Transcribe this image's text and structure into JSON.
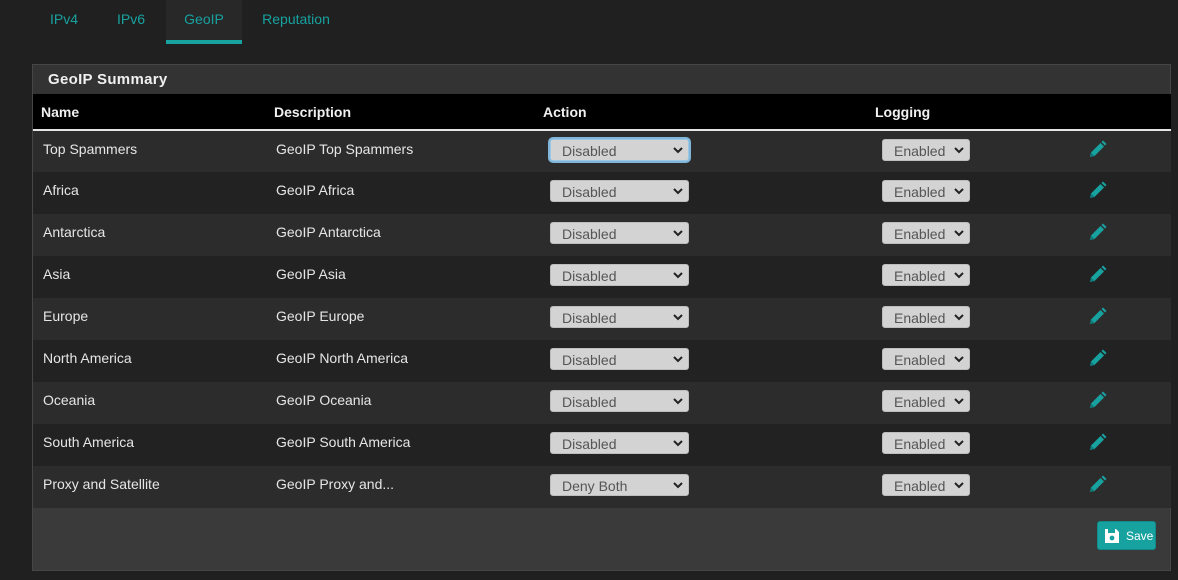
{
  "tabs": [
    {
      "label": "IPv4",
      "active": false
    },
    {
      "label": "IPv6",
      "active": false
    },
    {
      "label": "GeoIP",
      "active": true
    },
    {
      "label": "Reputation",
      "active": false
    }
  ],
  "panel": {
    "title": "GeoIP Summary",
    "columns": {
      "name": "Name",
      "description": "Description",
      "action": "Action",
      "logging": "Logging"
    },
    "rows": [
      {
        "name": "Top Spammers",
        "description": "GeoIP Top Spammers",
        "action": "Disabled",
        "logging": "Enabled"
      },
      {
        "name": "Africa",
        "description": "GeoIP Africa",
        "action": "Disabled",
        "logging": "Enabled"
      },
      {
        "name": "Antarctica",
        "description": "GeoIP Antarctica",
        "action": "Disabled",
        "logging": "Enabled"
      },
      {
        "name": "Asia",
        "description": "GeoIP Asia",
        "action": "Disabled",
        "logging": "Enabled"
      },
      {
        "name": "Europe",
        "description": "GeoIP Europe",
        "action": "Disabled",
        "logging": "Enabled"
      },
      {
        "name": "North America",
        "description": "GeoIP North America",
        "action": "Disabled",
        "logging": "Enabled"
      },
      {
        "name": "Oceania",
        "description": "GeoIP Oceania",
        "action": "Disabled",
        "logging": "Enabled"
      },
      {
        "name": "South America",
        "description": "GeoIP South America",
        "action": "Disabled",
        "logging": "Enabled"
      },
      {
        "name": "Proxy and Satellite",
        "description": "GeoIP Proxy and...",
        "action": "Deny Both",
        "logging": "Enabled"
      }
    ],
    "save_label": "Save"
  },
  "icons": {
    "edit": "pencil-icon",
    "save": "floppy-disk-icon",
    "dropdown": "chevron-down-icon"
  },
  "colors": {
    "accent": "#17a2a0",
    "background": "#202020",
    "panel": "#3a3a3a"
  }
}
